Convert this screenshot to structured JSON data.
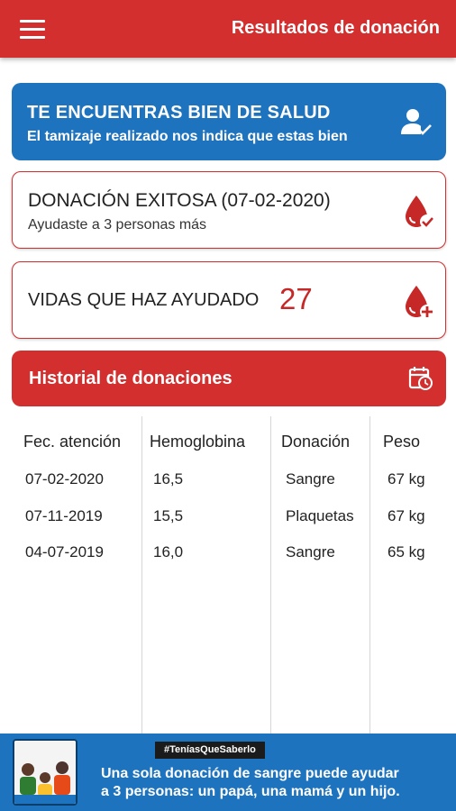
{
  "appbar": {
    "title": "Resultados de donación",
    "menu_icon": "hamburger-menu-icon"
  },
  "health": {
    "title": "TE ENCUENTRAS BIEN DE SALUD",
    "subtitle": "El tamizaje realizado nos indica que estas bien",
    "icon": "user-check-icon"
  },
  "donation": {
    "title": "DONACIÓN EXITOSA (07-02-2020)",
    "subtitle": "Ayudaste a 3 personas más",
    "icon": "blood-drop-check-icon"
  },
  "lives": {
    "label": "VIDAS QUE HAZ AYUDADO",
    "count": "27",
    "icon": "blood-drop-plus-icon"
  },
  "history": {
    "title": "Historial de donaciones",
    "icon": "calendar-clock-icon",
    "columns": [
      "Fec. atención",
      "Hemoglobina",
      "Donación",
      "Peso"
    ],
    "rows": [
      [
        "07-02-2020",
        "16,5",
        "Sangre",
        "67 kg"
      ],
      [
        "07-11-2019",
        "15,5",
        "Plaquetas",
        "67 kg"
      ],
      [
        "04-07-2019",
        "16,0",
        "Sangre",
        "65 kg"
      ]
    ]
  },
  "banner": {
    "tag": "#TeníasQueSaberlo",
    "line1": "Una sola donación de sangre puede ayudar",
    "line2": "a 3 personas: un papá, una mamá y un hijo."
  },
  "colors": {
    "primary_red": "#d32f2f",
    "primary_blue": "#1e73be",
    "accent_red": "#c62828"
  }
}
